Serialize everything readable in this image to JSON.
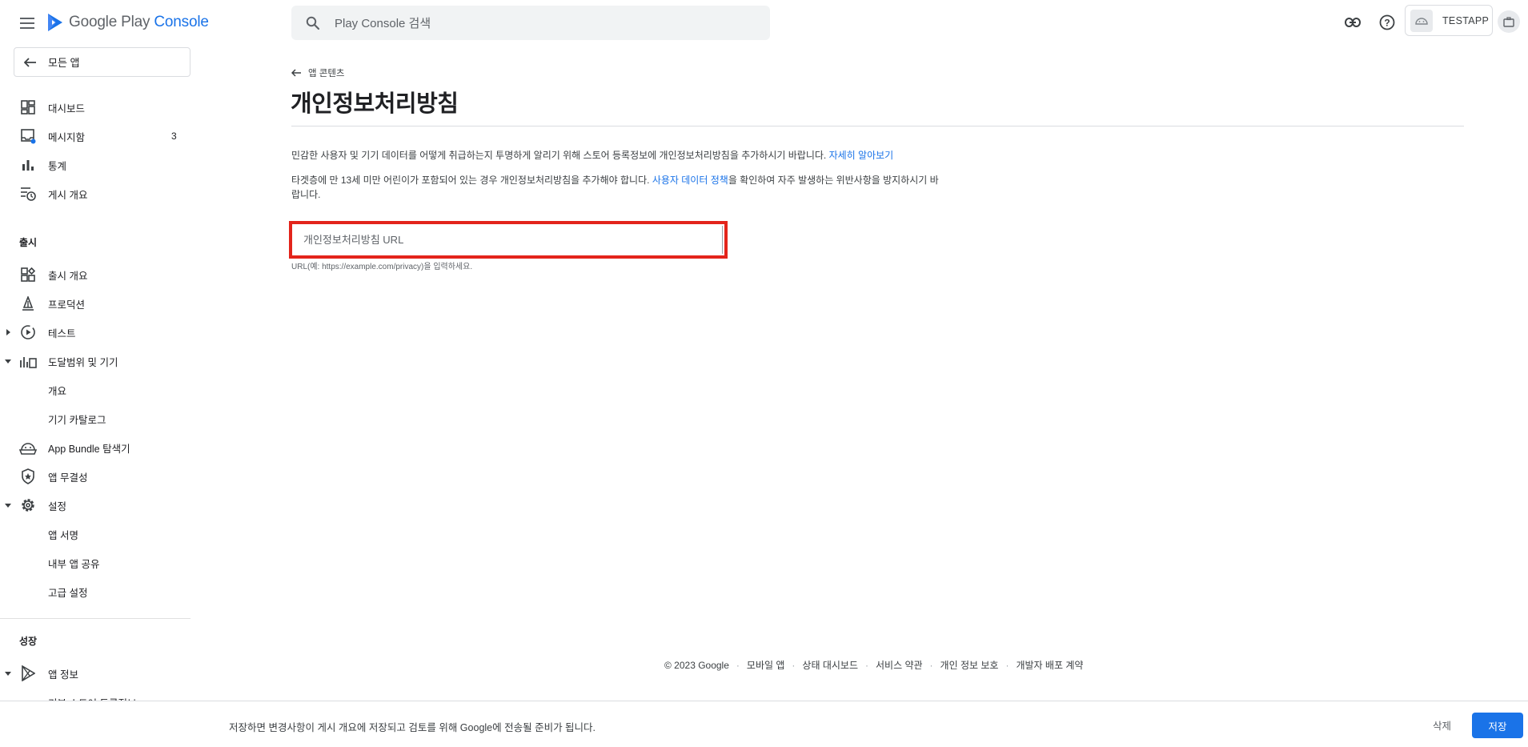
{
  "header": {
    "logo_prefix": "Google Play ",
    "logo_accent": "Console",
    "search_placeholder": "Play Console 검색",
    "account_name": "TESTAPP"
  },
  "sidebar": {
    "all_apps_label": "모든 앱",
    "items_top": [
      {
        "label": "대시보드",
        "icon": "dashboard-icon"
      },
      {
        "label": "메시지함",
        "icon": "inbox-icon",
        "badge": "3"
      },
      {
        "label": "통계",
        "icon": "bar-chart-icon"
      },
      {
        "label": "게시 개요",
        "icon": "publishing-overview-icon"
      }
    ],
    "section_release": "출시",
    "items_release": [
      {
        "label": "출시 개요",
        "icon": "release-overview-icon"
      },
      {
        "label": "프로덕션",
        "icon": "production-icon"
      },
      {
        "label": "테스트",
        "icon": "testing-icon",
        "caret": "right"
      },
      {
        "label": "도달범위 및 기기",
        "icon": "reach-devices-icon",
        "caret": "down"
      },
      {
        "label": "개요",
        "sub": true
      },
      {
        "label": "기기 카탈로그",
        "sub": true
      },
      {
        "label": "App Bundle 탐색기",
        "icon": "app-bundle-icon"
      },
      {
        "label": "앱 무결성",
        "icon": "app-integrity-icon"
      },
      {
        "label": "설정",
        "icon": "settings-icon",
        "caret": "down"
      },
      {
        "label": "앱 서명",
        "sub": true
      },
      {
        "label": "내부 앱 공유",
        "sub": true
      },
      {
        "label": "고급 설정",
        "sub": true
      }
    ],
    "section_growth": "성장",
    "items_growth": [
      {
        "label": "앱 정보",
        "icon": "play-store-icon",
        "caret": "down"
      },
      {
        "label": "기본 스토어 등록정보",
        "sub": true
      }
    ]
  },
  "main": {
    "back_label": "앱 콘텐츠",
    "title": "개인정보처리방침",
    "para1_text": "민감한 사용자 및 기기 데이터를 어떻게 취급하는지 투명하게 알리기 위해 스토어 등록정보에 개인정보처리방침을 추가하시기 바랍니다. ",
    "para1_link": "자세히 알아보기",
    "para2_text_a": "타겟층에 만 13세 미만 어린이가 포함되어 있는 경우 개인정보처리방침을 추가해야 합니다. ",
    "para2_link": "사용자 데이터 정책",
    "para2_text_b": "을 확인하여 자주 발생하는 위반사항을 방지하시기 바랍니다.",
    "url_placeholder": "개인정보처리방침 URL",
    "url_value": "",
    "helper_text": "URL(예: https://example.com/privacy)을 입력하세요."
  },
  "footer": {
    "copyright": "© 2023 Google",
    "links": [
      "모바일 앱",
      "상태 대시보드",
      "서비스 약관",
      "개인 정보 보호",
      "개발자 배포 계약"
    ]
  },
  "bottom_bar": {
    "message": "저장하면 변경사항이 게시 개요에 저장되고 검토를 위해 Google에 전송될 준비가 됩니다.",
    "discard_label": "삭제",
    "save_label": "저장"
  },
  "colors": {
    "accent": "#1a73e8",
    "highlight_border": "#e3241b",
    "inbox_dot": "#1a73e8"
  }
}
